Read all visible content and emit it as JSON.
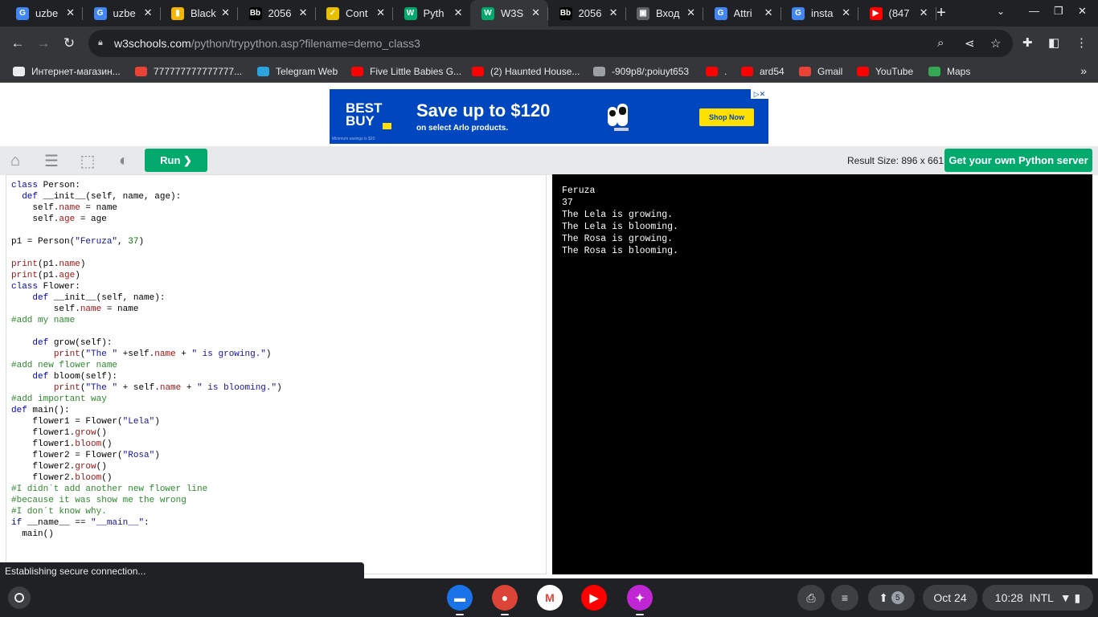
{
  "browser": {
    "tabs": [
      {
        "title": "uzbe",
        "favicon": "google-icon",
        "color": "#4285f4",
        "glyph": "G"
      },
      {
        "title": "uzbe",
        "favicon": "google-icon",
        "color": "#4285f4",
        "glyph": "G"
      },
      {
        "title": "Black",
        "favicon": "bar-chart-icon",
        "color": "#f4b400",
        "glyph": "▮"
      },
      {
        "title": "2056",
        "favicon": "bb-icon",
        "color": "#000000",
        "glyph": "Bb"
      },
      {
        "title": "Cont",
        "favicon": "check-icon",
        "color": "#e8c000",
        "glyph": "✓"
      },
      {
        "title": "Pyth",
        "favicon": "w3schools-icon",
        "color": "#04aa6d",
        "glyph": "W"
      },
      {
        "title": "W3S",
        "favicon": "w3schools-icon",
        "color": "#04aa6d",
        "glyph": "W"
      },
      {
        "title": "2056",
        "favicon": "bb-icon",
        "color": "#000000",
        "glyph": "Bb"
      },
      {
        "title": "Вход",
        "favicon": "login-icon",
        "color": "#5f6368",
        "glyph": "▣"
      },
      {
        "title": "Attri",
        "favicon": "google-icon",
        "color": "#4285f4",
        "glyph": "G"
      },
      {
        "title": "insta",
        "favicon": "google-icon",
        "color": "#4285f4",
        "glyph": "G"
      },
      {
        "title": "(847",
        "favicon": "youtube-icon",
        "color": "#ff0000",
        "glyph": "▶"
      }
    ],
    "active_tab": 6,
    "url_host": "w3schools.com",
    "url_path": "/python/trypython.asp?filename=demo_class3",
    "bookmarks": [
      {
        "label": "Интернет-магазин...",
        "icon": "shop-icon",
        "color": "#e8eaed"
      },
      {
        "label": "777777777777777...",
        "icon": "gmail-icon",
        "color": "#ea4335"
      },
      {
        "label": "Telegram Web",
        "icon": "telegram-icon",
        "color": "#2aa3df"
      },
      {
        "label": "Five Little Babies G...",
        "icon": "youtube-icon",
        "color": "#ff0000"
      },
      {
        "label": "(2) Haunted House...",
        "icon": "youtube-icon",
        "color": "#ff0000"
      },
      {
        "label": "-909p8/;poiuyt653",
        "icon": "globe-icon",
        "color": "#9aa0a6"
      },
      {
        "label": ".",
        "icon": "youtube-icon",
        "color": "#ff0000"
      },
      {
        "label": "ard54",
        "icon": "youtube-icon",
        "color": "#ff0000"
      },
      {
        "label": "Gmail",
        "icon": "gmail-icon",
        "color": "#ea4335"
      },
      {
        "label": "YouTube",
        "icon": "youtube-icon",
        "color": "#ff0000"
      },
      {
        "label": "Maps",
        "icon": "maps-icon",
        "color": "#34a853"
      }
    ]
  },
  "ad": {
    "brand": "BEST BUY",
    "headline": "Save up to $120",
    "sub": "on select Arlo products.",
    "button": "Shop Now",
    "fineprint": "Minimum savings is $20"
  },
  "tryit": {
    "run_label": "Run ❯",
    "result_size": "Result Size: 896 x 661",
    "own_server": "Get your own Python server"
  },
  "editor_code": "class Person:\n  def __init__(self, name, age):\n    self.name = name\n    self.age = age\n\np1 = Person(\"Feruza\", 37)\n\nprint(p1.name)\nprint(p1.age)\nclass Flower:\n    def __init__(self, name):\n        self.name = name\n#add my name\n\n    def grow(self):\n        print(\"The \" +self.name + \" is growing.\")\n#add new flower name\n    def bloom(self):\n        print(\"The \" + self.name + \" is blooming.\")\n#add important way\ndef main():\n    flower1 = Flower(\"Lela\")\n    flower1.grow()\n    flower1.bloom()\n    flower2 = Flower(\"Rosa\")\n    flower2.grow()\n    flower2.bloom()\n#I didn´t add another new flower line\n#because it was show me the wrong\n#I don´t know why.\nif __name__ == \"__main__\":\n  main()",
  "output_lines": [
    "Feruza",
    "37",
    "The Lela is growing.",
    "The Lela is blooming.",
    "The Rosa is growing.",
    "The Rosa is blooming."
  ],
  "status_text": "Establishing secure connection...",
  "shelf": {
    "apps": [
      {
        "name": "files-app",
        "color": "#1a73e8",
        "glyph": "▬",
        "running": true
      },
      {
        "name": "chrome-app",
        "color": "#db4437",
        "glyph": "●",
        "running": true
      },
      {
        "name": "gmail-app",
        "color": "#ffffff",
        "glyph": "M",
        "running": false
      },
      {
        "name": "youtube-app",
        "color": "#ff0000",
        "glyph": "▶",
        "running": false
      },
      {
        "name": "canvas-app",
        "color": "#c026d3",
        "glyph": "✦",
        "running": true
      }
    ],
    "notification_count": "5",
    "date": "Oct 24",
    "time": "10:28",
    "input_method": "INTL"
  }
}
